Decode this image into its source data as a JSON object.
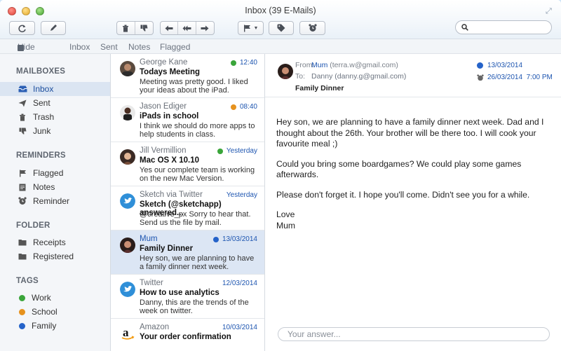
{
  "window": {
    "title": "Inbox (39 E-Mails)"
  },
  "toolbar": {
    "refresh_icon": "refresh-icon",
    "compose_icon": "pencil-icon",
    "delete_icon": "trash-icon",
    "junk_icon": "thumbs-down-icon",
    "reply_icon": "reply-icon",
    "reply_all_icon": "reply-all-icon",
    "forward_icon": "forward-icon",
    "flag_icon": "flag-icon",
    "tag_icon": "tag-icon",
    "reminder_icon": "alarm-clock-icon"
  },
  "search": {
    "placeholder": "",
    "value": ""
  },
  "navstrip": {
    "hide": "Hide",
    "items": [
      "Inbox",
      "Sent",
      "Notes",
      "Flagged"
    ]
  },
  "sidebar": {
    "mailboxes_head": "MAILBOXES",
    "mailboxes": [
      {
        "label": "Inbox",
        "icon": "inbox-icon",
        "selected": true
      },
      {
        "label": "Sent",
        "icon": "paper-plane-icon"
      },
      {
        "label": "Trash",
        "icon": "trash-icon"
      },
      {
        "label": "Junk",
        "icon": "thumbs-down-icon"
      }
    ],
    "reminders_head": "REMINDERS",
    "reminders": [
      {
        "label": "Flagged",
        "icon": "flag-icon"
      },
      {
        "label": "Notes",
        "icon": "note-icon"
      },
      {
        "label": "Reminder",
        "icon": "alarm-clock-icon"
      }
    ],
    "folder_head": "FOLDER",
    "folders": [
      {
        "label": "Receipts",
        "icon": "folder-icon"
      },
      {
        "label": "Registered",
        "icon": "folder-icon"
      }
    ],
    "tags_head": "TAGS",
    "tags": [
      {
        "label": "Work",
        "color": "#3aa53a"
      },
      {
        "label": "School",
        "color": "#e6921e"
      },
      {
        "label": "Family",
        "color": "#2563c9"
      }
    ]
  },
  "messages": [
    {
      "sender": "George Kane",
      "time": "12:40",
      "dot": "#3aa53a",
      "subject": "Todays Meeting",
      "preview": "Meeting was pretty good. I liked your ideas about the iPad."
    },
    {
      "sender": "Jason Ediger",
      "time": "08:40",
      "dot": "#e6921e",
      "subject": "iPads in school",
      "preview": "I think we should do more apps to help students in class."
    },
    {
      "sender": "Jill Vermillion",
      "time": "Yesterday",
      "dot": "#3aa53a",
      "subject": "Mac OS X 10.10",
      "preview": "Yes our complete team is working on the new Mac Version."
    },
    {
      "sender": "Sketch via Twitter",
      "time": "Yesterday",
      "dot": "",
      "subject": "Sketch (@sketchapp) answered...",
      "preview": "@creative_px Sorry to hear that. Send us the file by mail."
    },
    {
      "sender": "Mum",
      "time": "13/03/2014",
      "dot": "#2563c9",
      "subject": "Family Dinner",
      "preview": "Hey son, we are planning to have a family dinner next week.",
      "selected": true
    },
    {
      "sender": "Twitter",
      "time": "12/03/2014",
      "dot": "",
      "subject": "How to use analytics",
      "preview": "Danny, this are the trends of the week on twitter."
    },
    {
      "sender": "Amazon",
      "time": "10/03/2014",
      "dot": "",
      "subject": "Your order confirmation",
      "preview": ""
    }
  ],
  "reader": {
    "from_label": "From:",
    "from_name": "Mum",
    "from_email": "(terra.w@gmail.com)",
    "to_label": "To:",
    "to_value": "Danny (danny.g@gmail.com)",
    "subject": "Family Dinner",
    "date": "13/03/2014",
    "date_dot": "#2563c9",
    "reminder": "26/03/2014  7:00 PM",
    "body": [
      "Hey son, we are planning to have a family dinner next week. Dad and I thought about the 26th. Your brother will be there too. I will cook your favourite meal ;)",
      "Could you bring some boardgames? We could play some games afterwards.",
      "Please don't forget it. I hope you'll come. Didn't see you for a while."
    ],
    "closing": "Love",
    "signature": "Mum",
    "answer_placeholder": "Your answer..."
  }
}
